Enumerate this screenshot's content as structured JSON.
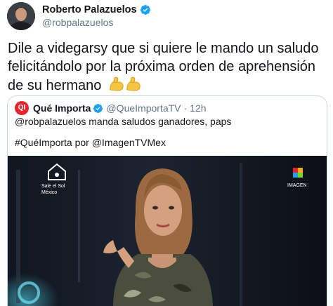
{
  "author": {
    "display_name": "Roberto Palazuelos",
    "handle": "@robpalazuelos",
    "verified_icon": "verified-badge-icon"
  },
  "tweet": {
    "text": "Dile a videgarsy que si quiere le mando un saludo felicitándolo por la próxima  orden de aprehensión  de su hermano",
    "emoji": "💪💪"
  },
  "quoted": {
    "display_name": "Qué Importa",
    "handle": "@QueImportaTV",
    "separator": "·",
    "time": "12h",
    "line1": "@robpalazuelos manda saludos ganadores, paps",
    "line2": "#QuéImporta por @ImagenTVMex",
    "avatar_text": "QI"
  },
  "media": {
    "left_logo_line1": "Sale el Sol",
    "left_logo_line2": "México",
    "right_logo_text": "IMAGEN"
  },
  "colors": {
    "accent_blue": "#1da1f2",
    "text": "#14171a",
    "muted": "#657786",
    "border": "#ccd6dd",
    "quote_avatar": "#e3262d"
  }
}
